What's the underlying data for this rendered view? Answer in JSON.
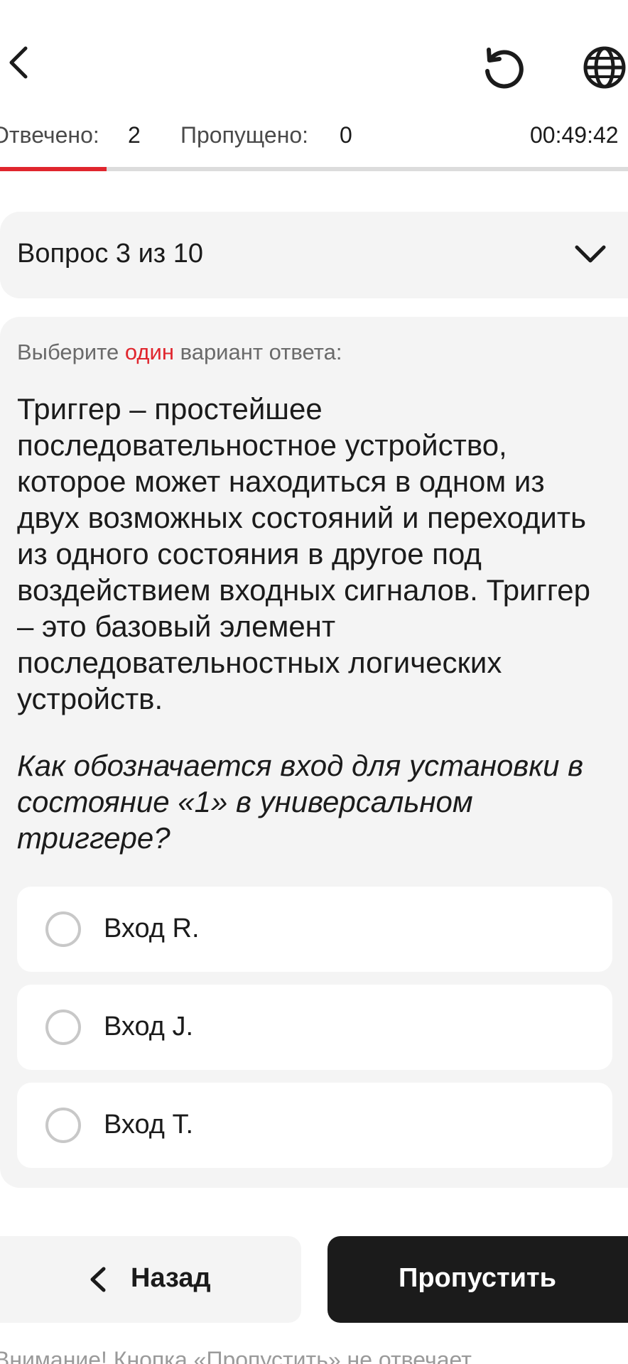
{
  "icons": {
    "back": "chevron-left-icon",
    "refresh": "refresh-icon",
    "language": "globe-icon",
    "expand": "chevron-down-icon",
    "radio": "radio-unchecked-icon"
  },
  "colors": {
    "accent": "#e0262e",
    "primary_button": "#1b1b1b",
    "card_background": "#f4f4f4"
  },
  "stats": {
    "answered_label": "Отвечено:",
    "answered_value": "2",
    "skipped_label": "Пропущено:",
    "skipped_value": "0",
    "timer": "00:49:42"
  },
  "progress": {
    "fraction": 0.17
  },
  "question_selector": {
    "label": "Вопрос 3 из 10"
  },
  "question": {
    "instruction_before": "Выберите ",
    "instruction_accent": "один",
    "instruction_after": " вариант ответа:",
    "text": "Триггер – простейшее последовательностное устройство, которое может находиться в одном из двух возможных состояний и переходить из одного состояния в другое под воздействием входных сигналов. Триггер – это базовый элемент последовательностных логических устройств.",
    "prompt": "Как обозначается вход для установки в состояние «1» в универсальном триггере?"
  },
  "answers": [
    {
      "label": "Вход R.",
      "selected": false
    },
    {
      "label": "Вход J.",
      "selected": false
    },
    {
      "label": "Вход T.",
      "selected": false
    }
  ],
  "buttons": {
    "back_label": "Назад",
    "skip_label": "Пропустить"
  },
  "footnote": "Внимание! Кнопка «Пропустить» не отвечает"
}
